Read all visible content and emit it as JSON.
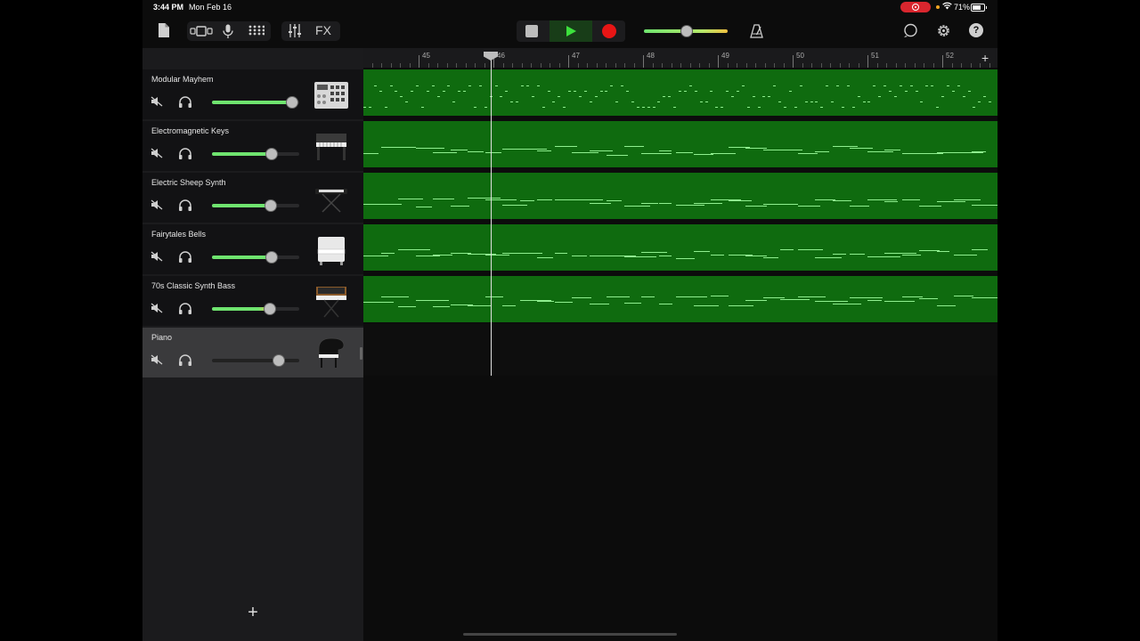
{
  "status_bar": {
    "time": "3:44 PM",
    "date": "Mon Feb 16",
    "battery": "71%"
  },
  "toolbar": {
    "fx_label": "FX",
    "help_label": "?",
    "accent_play": "#3ce03c",
    "accent_record": "#e81515",
    "master_volume": 0.5
  },
  "ruler": {
    "bars": [
      "45",
      "46",
      "47",
      "48",
      "49",
      "50",
      "51",
      "52"
    ]
  },
  "tracks": [
    {
      "name": "Modular Mayhem",
      "volume": 0.92,
      "instrument_icon": "drum-machine-icon"
    },
    {
      "name": "Electromagnetic Keys",
      "volume": 0.68,
      "instrument_icon": "electric-piano-icon"
    },
    {
      "name": "Electric Sheep Synth",
      "volume": 0.67,
      "instrument_icon": "synth-keyboard-icon"
    },
    {
      "name": "Fairytales Bells",
      "volume": 0.68,
      "instrument_icon": "bells-keyboard-icon"
    },
    {
      "name": "70s Classic Synth Bass",
      "volume": 0.66,
      "instrument_icon": "analog-synth-icon"
    },
    {
      "name": "Piano",
      "volume": 0.77,
      "instrument_icon": "grand-piano-icon",
      "selected": true
    }
  ],
  "add_track_label": "+",
  "region_color": "#0f6b0f"
}
